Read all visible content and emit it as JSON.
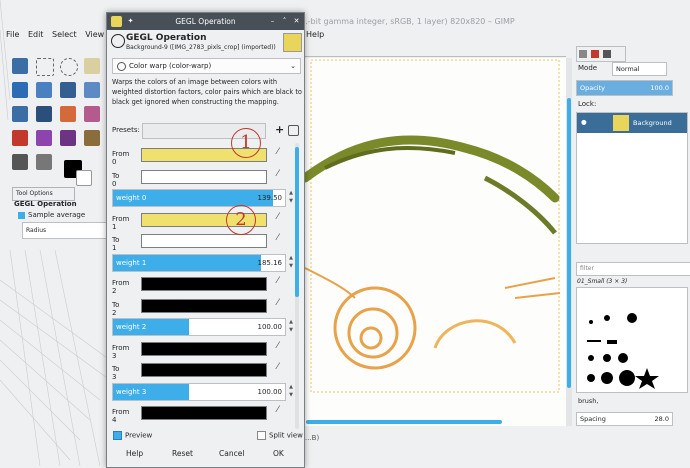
{
  "main_window": {
    "title": "...-bit gamma integer, sRGB, 1 layer) 820x820 – GIMP",
    "menu": [
      "File",
      "Edit",
      "Select",
      "View"
    ],
    "menu_help": "Help",
    "status": "...B)"
  },
  "tool_options": {
    "tab_label": "Tool Options",
    "title": "GEGL Operation",
    "sample_average": "Sample average",
    "radius": "Radius"
  },
  "layers_panel": {
    "mode_label": "Mode",
    "mode_value": "Normal",
    "opacity_label": "Opacity",
    "opacity_value": "100.0",
    "lock_label": "Lock:",
    "layer_name": "Background"
  },
  "brushes_panel": {
    "filter_placeholder": "filter",
    "brush_set": "01_Small (3 × 3)",
    "brush_tag": "brush,",
    "spacing_label": "Spacing",
    "spacing_value": "28.0"
  },
  "dialog": {
    "title": "GEGL Operation",
    "header_title": "GEGL Operation",
    "header_subtitle": "Background-9 ([IMG_2783_pixls_crop] (imported))",
    "operation": "Color warp (color-warp)",
    "description": "Warps the colors of an image between colors with weighted distortion factors, color pairs which are black to black get ignored when constructing the mapping.",
    "presets_label": "Presets:",
    "rows": [
      {
        "type": "color",
        "label": "From 0",
        "color": "#f0e06e"
      },
      {
        "type": "color",
        "label": "To 0",
        "color": "#ffffff"
      },
      {
        "type": "slider",
        "label": "weight 0",
        "value": "139.50",
        "fill": 0.93
      },
      {
        "type": "color",
        "label": "From 1",
        "color": "#f0e06e"
      },
      {
        "type": "color",
        "label": "To 1",
        "color": "#ffffff"
      },
      {
        "type": "slider",
        "label": "weight 1",
        "value": "185.16",
        "fill": 0.86
      },
      {
        "type": "color",
        "label": "From 2",
        "color": "#000000"
      },
      {
        "type": "color",
        "label": "To 2",
        "color": "#000000"
      },
      {
        "type": "slider",
        "label": "weight 2",
        "value": "100.00",
        "fill": 0.44
      },
      {
        "type": "color",
        "label": "From 3",
        "color": "#000000"
      },
      {
        "type": "color",
        "label": "To 3",
        "color": "#000000"
      },
      {
        "type": "slider",
        "label": "weight 3",
        "value": "100.00",
        "fill": 0.44
      },
      {
        "type": "color",
        "label": "From 4",
        "color": "#000000"
      }
    ],
    "preview_label": "Preview",
    "split_label": "Split view",
    "buttons": [
      "Help",
      "Reset",
      "Cancel",
      "OK"
    ]
  },
  "annotations": [
    "1",
    "2"
  ],
  "colors": {
    "accent": "#3daee9",
    "titlebar": "#475057",
    "annotation": "#c0392b"
  }
}
